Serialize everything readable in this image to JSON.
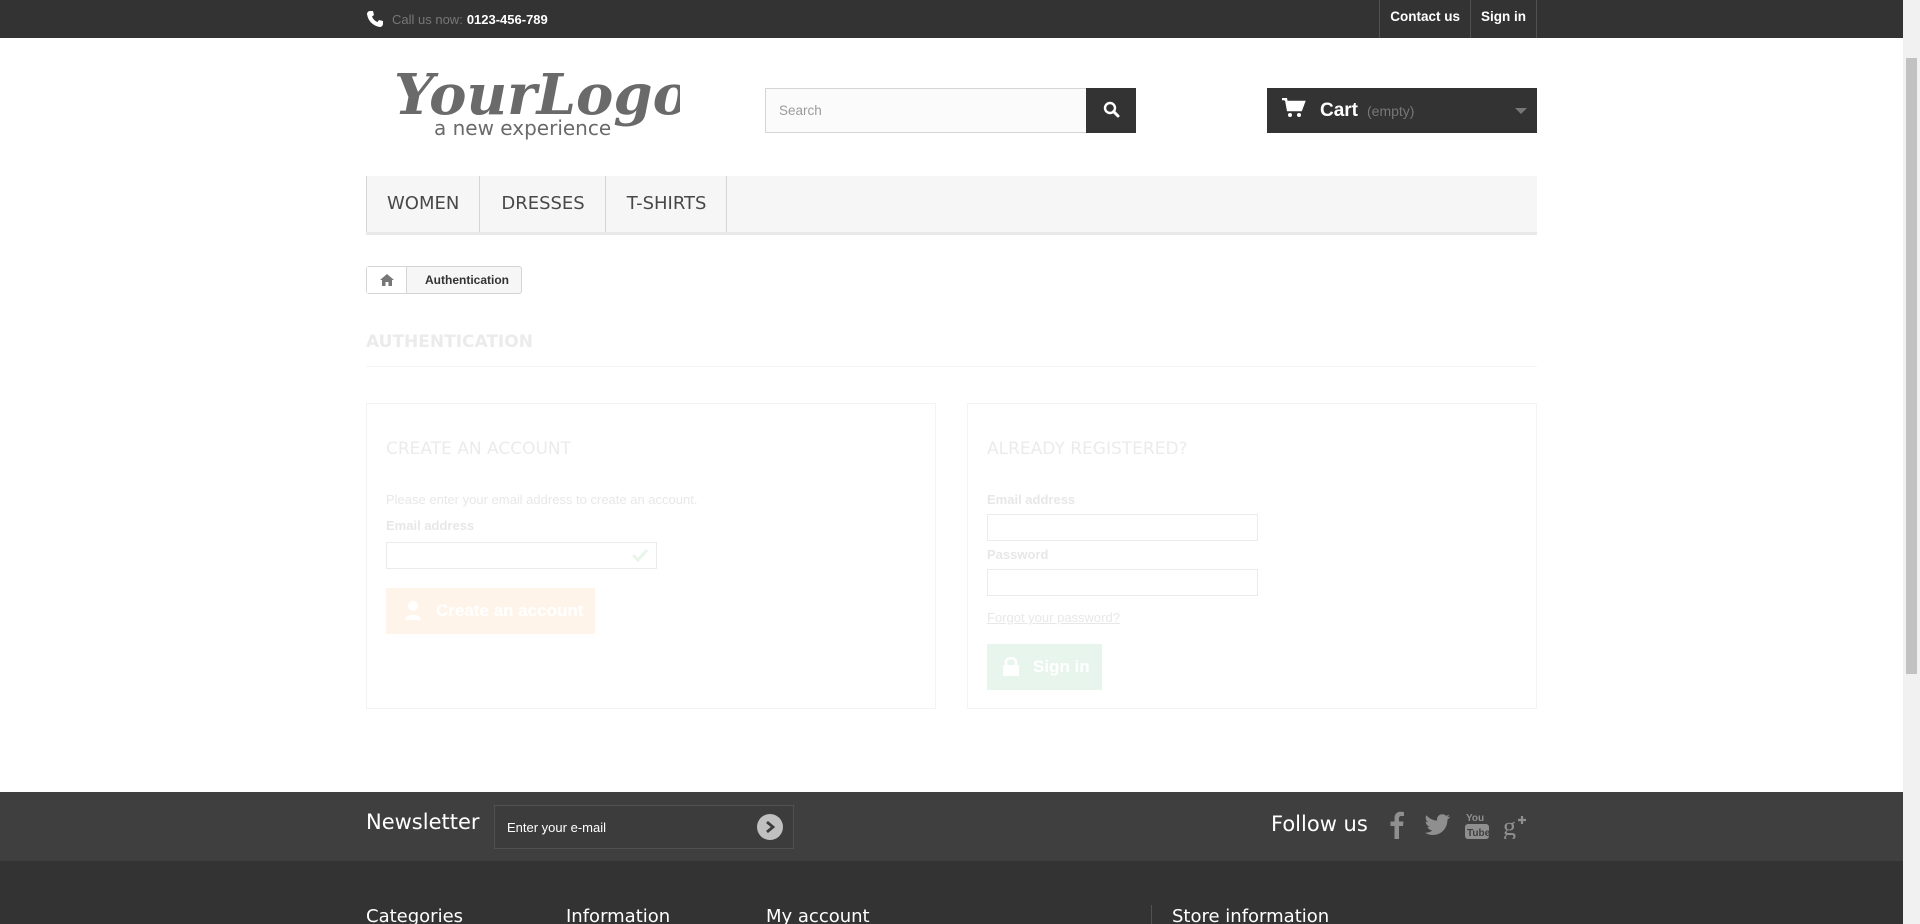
{
  "topbar": {
    "call_label": "Call us now:",
    "phone": "0123-456-789",
    "links": [
      "Contact us",
      "Sign in"
    ]
  },
  "logo": {
    "text": "YourLogo",
    "tagline": "a new experience"
  },
  "search": {
    "placeholder": "Search",
    "icon": "search-icon"
  },
  "cart": {
    "label": "Cart",
    "status": "(empty)"
  },
  "menu": {
    "items": [
      "WOMEN",
      "DRESSES",
      "T-SHIRTS"
    ]
  },
  "breadcrumb": {
    "current": "Authentication"
  },
  "page": {
    "title": "AUTHENTICATION"
  },
  "create_account": {
    "title": "CREATE AN ACCOUNT",
    "hint": "Please enter your email address to create an account.",
    "email_label": "Email address",
    "button": "Create an account"
  },
  "login": {
    "title": "ALREADY REGISTERED?",
    "email_label": "Email address",
    "password_label": "Password",
    "forgot": "Forgot your password?",
    "button": "Sign in"
  },
  "footer": {
    "newsletter_title": "Newsletter",
    "newsletter_placeholder": "Enter your e-mail",
    "follow_title": "Follow us",
    "social": [
      "facebook-icon",
      "twitter-icon",
      "youtube-icon",
      "google-plus-icon"
    ],
    "columns": [
      "Categories",
      "Information",
      "My account",
      "Store information"
    ]
  },
  "colors": {
    "topbar": "#333333",
    "create_button": "#f4a34e",
    "signin_button": "#3aa762",
    "newsletter_bar": "#3f3f3f"
  }
}
